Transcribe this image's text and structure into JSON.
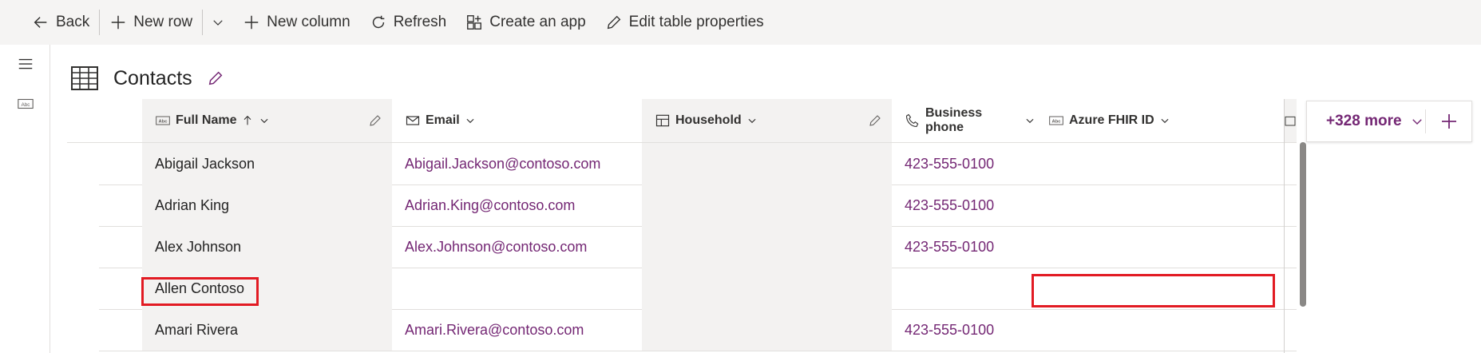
{
  "toolbar": {
    "back": "Back",
    "new_row": "New row",
    "new_column": "New column",
    "refresh": "Refresh",
    "create_app": "Create an app",
    "edit_table": "Edit table properties"
  },
  "page": {
    "title": "Contacts"
  },
  "columns": [
    {
      "label": "Full Name",
      "icon": "text-field-icon",
      "sort": "ascending"
    },
    {
      "label": "Email",
      "icon": "mail-icon"
    },
    {
      "label": "Household",
      "icon": "lookup-icon"
    },
    {
      "label": "Business phone",
      "icon": "phone-icon"
    },
    {
      "label": "Azure FHIR ID",
      "icon": "text-field-icon"
    }
  ],
  "more_columns": {
    "label": "+328 more"
  },
  "rows": [
    {
      "full_name": "Abigail Jackson",
      "email": "Abigail.Jackson@contoso.com",
      "household": "",
      "phone": "423-555-0100",
      "fhir": ""
    },
    {
      "full_name": "Adrian King",
      "email": "Adrian.King@contoso.com",
      "household": "",
      "phone": "423-555-0100",
      "fhir": ""
    },
    {
      "full_name": "Alex Johnson",
      "email": "Alex.Johnson@contoso.com",
      "household": "",
      "phone": "423-555-0100",
      "fhir": ""
    },
    {
      "full_name": "Allen Contoso",
      "email": "",
      "household": "",
      "phone": "",
      "fhir": ""
    },
    {
      "full_name": "Amari Rivera",
      "email": "Amari.Rivera@contoso.com",
      "household": "",
      "phone": "423-555-0100",
      "fhir": ""
    }
  ],
  "colors": {
    "accent": "#742774",
    "highlight": "#e21b23",
    "toolbar_bg": "#f5f4f3"
  }
}
